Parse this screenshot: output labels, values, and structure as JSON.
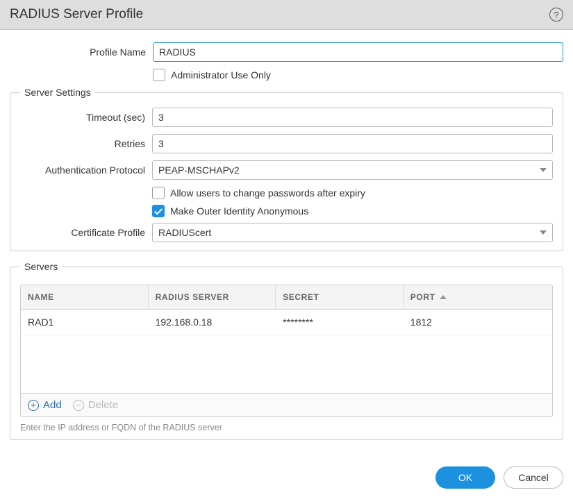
{
  "title": "RADIUS Server Profile",
  "profile_name": {
    "label": "Profile Name",
    "value": "RADIUS"
  },
  "admin_only": {
    "label": "Administrator Use Only",
    "checked": false
  },
  "server_settings": {
    "legend": "Server Settings",
    "timeout": {
      "label": "Timeout (sec)",
      "value": "3"
    },
    "retries": {
      "label": "Retries",
      "value": "3"
    },
    "auth_protocol": {
      "label": "Authentication Protocol",
      "value": "PEAP-MSCHAPv2"
    },
    "allow_pw_change": {
      "label": "Allow users to change passwords after expiry",
      "checked": false
    },
    "anon_outer": {
      "label": "Make Outer Identity Anonymous",
      "checked": true
    },
    "cert_profile": {
      "label": "Certificate Profile",
      "value": "RADIUScert"
    }
  },
  "servers": {
    "legend": "Servers",
    "columns": {
      "name": "NAME",
      "server": "RADIUS SERVER",
      "secret": "SECRET",
      "port": "PORT"
    },
    "rows": [
      {
        "name": "RAD1",
        "server": "192.168.0.18",
        "secret": "********",
        "port": "1812"
      }
    ],
    "add_label": "Add",
    "delete_label": "Delete",
    "hint": "Enter the IP address or FQDN of the RADIUS server"
  },
  "buttons": {
    "ok": "OK",
    "cancel": "Cancel"
  }
}
